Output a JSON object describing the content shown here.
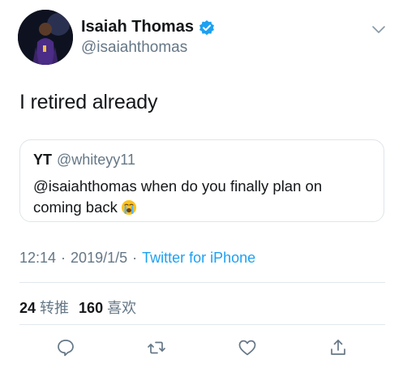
{
  "tweet": {
    "author": {
      "display_name": "Isaiah Thomas",
      "handle": "@isaiahthomas",
      "verified": true,
      "avatar_icon": "player-avatar"
    },
    "text": "I retired already",
    "quoted": {
      "display_name": "YT",
      "handle": "@whiteyy11",
      "text": "@isaiahthomas when do you finally plan on coming back",
      "emoji": "loudly-crying-face"
    },
    "meta": {
      "time": "12:14",
      "separator": "·",
      "date": "2019/1/5",
      "source": "Twitter for iPhone"
    },
    "stats": {
      "retweets_count": "24",
      "retweets_label": "转推",
      "likes_count": "160",
      "likes_label": "喜欢"
    }
  },
  "actions": [
    {
      "name": "reply",
      "icon": "comment-icon"
    },
    {
      "name": "retweet",
      "icon": "retweet-icon"
    },
    {
      "name": "like",
      "icon": "heart-icon"
    },
    {
      "name": "share",
      "icon": "share-icon"
    }
  ],
  "colors": {
    "text": "#14171a",
    "secondary": "#657786",
    "link": "#1da1f2",
    "verified": "#1da1f2",
    "divider": "#e1e8ed"
  }
}
